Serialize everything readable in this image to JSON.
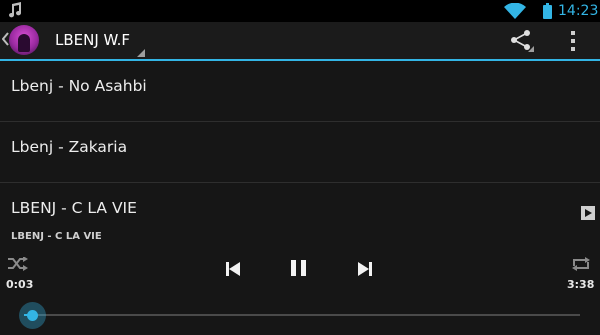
{
  "status_bar": {
    "time": "14:23"
  },
  "action_bar": {
    "title": "LBENJ W.F"
  },
  "tracks": [
    {
      "label": "Lbenj - No Asahbi",
      "playing": false
    },
    {
      "label": "Lbenj - Zakaria",
      "playing": false
    },
    {
      "label": "LBENJ - C LA VIE",
      "playing": true
    }
  ],
  "player": {
    "now_playing": "LBENJ - C LA VIE",
    "current_time": "0:03",
    "total_time": "3:38",
    "progress": 0.014
  },
  "colors": {
    "accent": "#33b5e5",
    "background": "#141414"
  },
  "icons": [
    "music-note-icon",
    "wifi-icon",
    "battery-icon",
    "back-chevron-icon",
    "share-icon",
    "overflow-menu-icon",
    "play-indicator-icon",
    "shuffle-icon",
    "previous-icon",
    "pause-icon",
    "next-icon",
    "repeat-icon"
  ]
}
